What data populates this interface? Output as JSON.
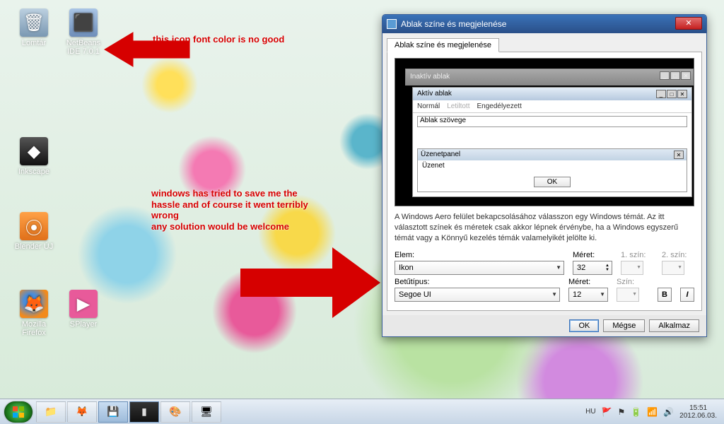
{
  "desktop": {
    "icons": [
      {
        "label": "Lomtár",
        "glyph": "🗑"
      },
      {
        "label": "NetBeans IDE 7.0.1",
        "glyph": "⬛"
      },
      {
        "label": "Inkscape",
        "glyph": "◆"
      },
      {
        "label": "Blender ÚJ",
        "glyph": "⦿"
      },
      {
        "label": "Mozilla Firefox",
        "glyph": "🦊"
      },
      {
        "label": "SPlayer",
        "glyph": "▶"
      }
    ]
  },
  "annotations": {
    "top": "this icon font color is no good",
    "middle": "windows has tried to save me the hassle and of course it went terribly wrong\nany solution would be welcome"
  },
  "dialog": {
    "title": "Ablak színe és megjelenése",
    "tab": "Ablak színe és megjelenése",
    "preview": {
      "inactive": "Inaktív ablak",
      "active": "Aktív ablak",
      "menu_normal": "Normál",
      "menu_disabled": "Letiltott",
      "menu_enabled": "Engedélyezett",
      "window_text": "Ablak szövege",
      "msg_title": "Üzenetpanel",
      "msg_body": "Üzenet",
      "ok": "OK"
    },
    "description": "A Windows Aero felület bekapcsolásához válasszon egy Windows témát. Az itt választott színek és méretek csak akkor lépnek érvénybe, ha a Windows egyszerű témát vagy a Könnyű kezelés témák valamelyikét jelölte ki.",
    "labels": {
      "elem": "Elem:",
      "meret": "Méret:",
      "szin1": "1. szín:",
      "szin2": "2. szín:",
      "betutipus": "Betűtípus:",
      "szin": "Szín:"
    },
    "values": {
      "elem": "Ikon",
      "meret_elem": "32",
      "betutipus": "Segoe UI",
      "meret_font": "12"
    },
    "style_buttons": {
      "bold": "B",
      "italic": "I"
    },
    "buttons": {
      "ok": "OK",
      "cancel": "Mégse",
      "apply": "Alkalmaz"
    }
  },
  "taskbar": {
    "lang": "HU",
    "time": "15:51",
    "date": "2012.06.03."
  }
}
